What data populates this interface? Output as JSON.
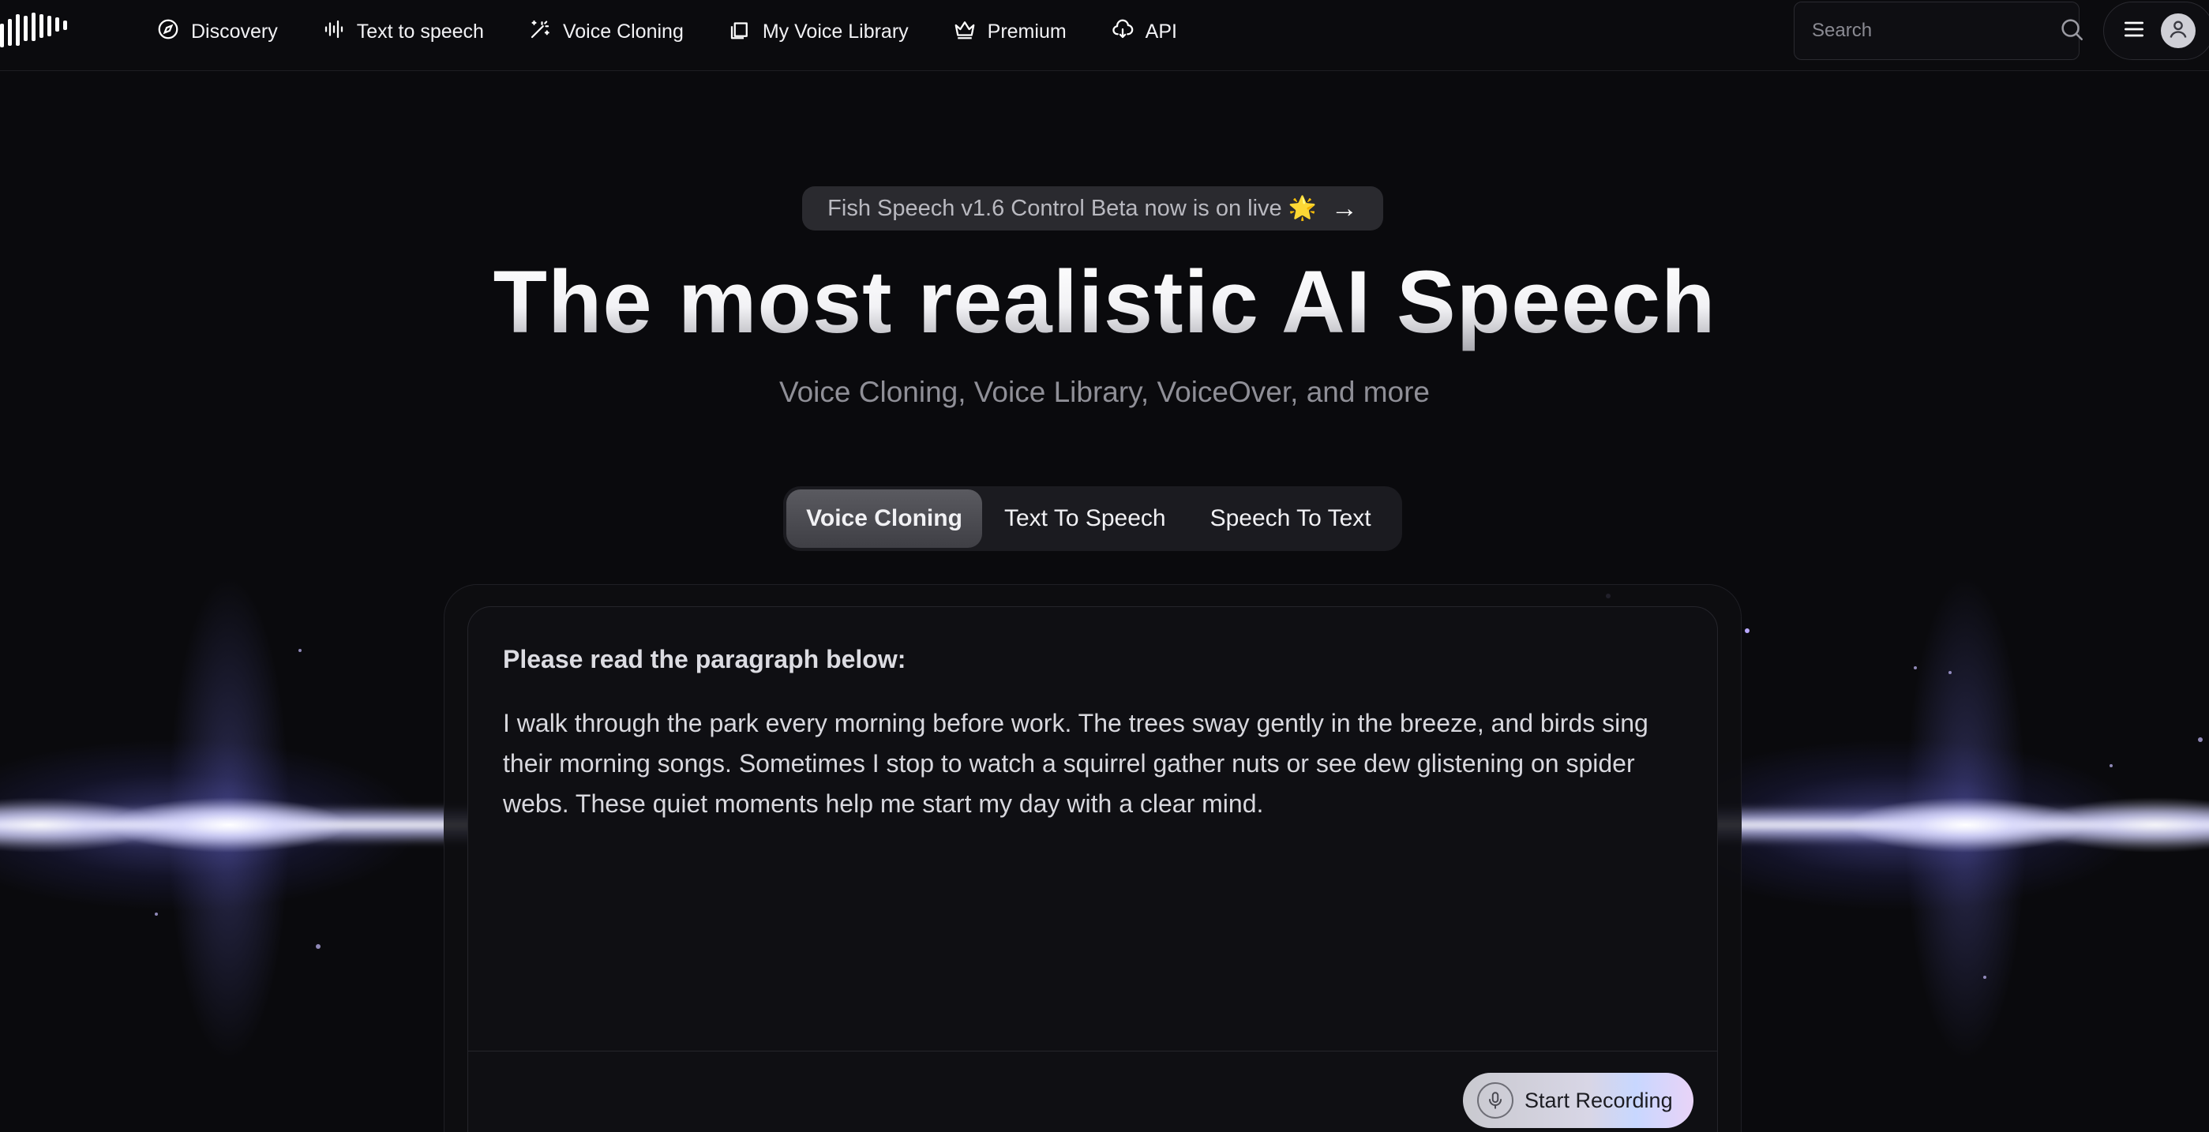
{
  "nav": {
    "items": [
      {
        "label": "Discovery",
        "icon": "compass-icon"
      },
      {
        "label": "Text to speech",
        "icon": "waveform-icon"
      },
      {
        "label": "Voice Cloning",
        "icon": "magic-wand-icon"
      },
      {
        "label": "My Voice Library",
        "icon": "library-icon"
      },
      {
        "label": "Premium",
        "icon": "crown-icon"
      },
      {
        "label": "API",
        "icon": "cloud-icon"
      }
    ]
  },
  "search": {
    "placeholder": "Search",
    "icon": "search-icon"
  },
  "account": {
    "menu_icon": "hamburger-icon",
    "avatar_icon": "user-icon"
  },
  "announcement": {
    "text": "Fish Speech v1.6 Control Beta now is on live 🌟",
    "arrow": "→"
  },
  "hero": {
    "title": "The most realistic AI Speech",
    "subtitle": "Voice Cloning, Voice Library, VoiceOver, and more"
  },
  "tabs": [
    {
      "label": "Voice Cloning",
      "active": true
    },
    {
      "label": "Text To Speech",
      "active": false
    },
    {
      "label": "Speech To Text",
      "active": false
    }
  ],
  "card": {
    "title": "Please read the paragraph below:",
    "text": "I walk through the park every morning before work. The trees sway gently in the breeze, and birds sing their morning songs. Sometimes I stop to watch a squirrel gather nuts or see dew glistening on spider webs. These quiet moments help me start my day with a clear mind.",
    "record_label": "Start Recording",
    "record_icon": "microphone-icon"
  },
  "colors": {
    "background": "#0a0a0d",
    "glow": "#c8c8ff",
    "card": "#0f0f13",
    "accent_gradient_end": "#e9d3f7"
  }
}
